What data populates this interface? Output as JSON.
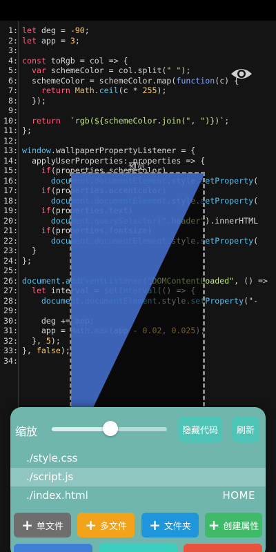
{
  "code_lines": [
    {
      "n": "1:",
      "tokens": [
        [
          "k",
          "let"
        ],
        [
          "o",
          " deg = "
        ],
        [
          "p",
          "-90"
        ],
        [
          "o",
          ";"
        ]
      ]
    },
    {
      "n": "2:",
      "tokens": [
        [
          "k",
          "let"
        ],
        [
          "o",
          " app = "
        ],
        [
          "p",
          "3"
        ],
        [
          "o",
          ";"
        ]
      ]
    },
    {
      "n": "3:",
      "tokens": []
    },
    {
      "n": "4:",
      "tokens": [
        [
          "k",
          "const"
        ],
        [
          "o",
          " toRgb = col => {"
        ]
      ]
    },
    {
      "n": "5:",
      "tokens": [
        [
          "k",
          "  var"
        ],
        [
          "o",
          " schemeColor = col.split("
        ],
        [
          "s",
          "\" \""
        ],
        [
          "o",
          ");"
        ]
      ]
    },
    {
      "n": "6:",
      "tokens": [
        [
          "o",
          "  schemeColor = schemeColor.map("
        ],
        [
          "f",
          "function"
        ],
        [
          "o",
          "(c) {"
        ]
      ]
    },
    {
      "n": "7:",
      "tokens": [
        [
          "k",
          "    return"
        ],
        [
          "o",
          " "
        ],
        [
          "y",
          "Math"
        ],
        [
          "o",
          "."
        ],
        [
          "c",
          "ceil"
        ],
        [
          "o",
          "(c * "
        ],
        [
          "p",
          "255"
        ],
        [
          "o",
          ");"
        ]
      ]
    },
    {
      "n": "8:",
      "tokens": [
        [
          "o",
          "  });"
        ]
      ]
    },
    {
      "n": "9:",
      "tokens": []
    },
    {
      "n": "10:",
      "tokens": [
        [
          "k",
          "  return"
        ],
        [
          "o",
          "  "
        ],
        [
          "s",
          "`rgb(${schemeColor.join(\", \")})`"
        ],
        [
          "o",
          ";"
        ]
      ]
    },
    {
      "n": "11:",
      "tokens": [
        [
          "o",
          "};"
        ]
      ]
    },
    {
      "n": "12:",
      "tokens": []
    },
    {
      "n": "13:",
      "tokens": [
        [
          "c",
          "window"
        ],
        [
          "o",
          ".wallpaperPropertyListener = {"
        ]
      ]
    },
    {
      "n": "14:",
      "tokens": [
        [
          "o",
          "  applyUserProperties: properties => {"
        ]
      ]
    },
    {
      "n": "15:",
      "tokens": [
        [
          "k",
          "    if"
        ],
        [
          "o",
          "(properties.schemecolor)"
        ]
      ]
    },
    {
      "n": "16:",
      "tokens": [
        [
          "o",
          "      "
        ],
        [
          "c",
          "document"
        ],
        [
          "o",
          "."
        ],
        [
          "c",
          "documentElement"
        ],
        [
          "o",
          ".style."
        ],
        [
          "c",
          "setProperty"
        ],
        [
          "o",
          "("
        ]
      ]
    },
    {
      "n": "17:",
      "tokens": [
        [
          "k",
          "    if"
        ],
        [
          "o",
          "(properties.accentcolor)"
        ]
      ]
    },
    {
      "n": "18:",
      "tokens": [
        [
          "o",
          "      "
        ],
        [
          "c",
          "document"
        ],
        [
          "o",
          "."
        ],
        [
          "c",
          "documentElement"
        ],
        [
          "o",
          ".style."
        ],
        [
          "c",
          "setProperty"
        ],
        [
          "o",
          "("
        ]
      ]
    },
    {
      "n": "19:",
      "tokens": [
        [
          "k",
          "    if"
        ],
        [
          "o",
          "(properties.text)"
        ]
      ]
    },
    {
      "n": "20:",
      "tokens": [
        [
          "o",
          "      "
        ],
        [
          "c",
          "document"
        ],
        [
          "o",
          "."
        ],
        [
          "c",
          "querySelector"
        ],
        [
          "o",
          "("
        ],
        [
          "s",
          "\".header\""
        ],
        [
          "o",
          ").innerHTML"
        ]
      ]
    },
    {
      "n": "21:",
      "tokens": [
        [
          "k",
          "    if"
        ],
        [
          "o",
          "(properties.fontsize)"
        ]
      ]
    },
    {
      "n": "22:",
      "tokens": [
        [
          "o",
          "      "
        ],
        [
          "c",
          "document"
        ],
        [
          "o",
          "."
        ],
        [
          "c",
          "documentElement"
        ],
        [
          "o",
          ".style."
        ],
        [
          "c",
          "setProperty"
        ],
        [
          "o",
          "("
        ]
      ]
    },
    {
      "n": "23:",
      "tokens": [
        [
          "o",
          "  }"
        ]
      ]
    },
    {
      "n": "24:",
      "tokens": [
        [
          "o",
          "};"
        ]
      ]
    },
    {
      "n": "25:",
      "tokens": []
    },
    {
      "n": "26:",
      "tokens": [
        [
          "c",
          "document"
        ],
        [
          "o",
          "."
        ],
        [
          "c",
          "addEventListener"
        ],
        [
          "o",
          "("
        ],
        [
          "s",
          "\"DOMContentLoaded\""
        ],
        [
          "o",
          ", () =>"
        ]
      ]
    },
    {
      "n": "27:",
      "tokens": [
        [
          "k",
          "  let"
        ],
        [
          "o",
          " interval = "
        ],
        [
          "c",
          "setInterval"
        ],
        [
          "o",
          "(() => {"
        ]
      ]
    },
    {
      "n": "28:",
      "tokens": [
        [
          "o",
          "    "
        ],
        [
          "c",
          "document"
        ],
        [
          "o",
          "."
        ],
        [
          "c",
          "documentElement"
        ],
        [
          "o",
          ".style."
        ],
        [
          "c",
          "setProperty"
        ],
        [
          "o",
          "(\"-"
        ]
      ]
    },
    {
      "n": "29:",
      "tokens": []
    },
    {
      "n": "30:",
      "tokens": [
        [
          "o",
          "    deg += app;"
        ]
      ]
    },
    {
      "n": "31:",
      "tokens": [
        [
          "o",
          "    app = "
        ],
        [
          "y",
          "Math"
        ],
        [
          "o",
          "."
        ],
        [
          "c",
          "max"
        ],
        [
          "o",
          "(app - "
        ],
        [
          "p",
          "0.02"
        ],
        [
          "o",
          ", "
        ],
        [
          "p",
          "0.025"
        ],
        [
          "o",
          ");"
        ]
      ]
    },
    {
      "n": "32:",
      "tokens": [
        [
          "o",
          "  }, "
        ],
        [
          "p",
          "5"
        ],
        [
          "o",
          ");"
        ]
      ]
    },
    {
      "n": "33:",
      "tokens": [
        [
          "o",
          "}, "
        ],
        [
          "p",
          "false"
        ],
        [
          "o",
          ");"
        ]
      ]
    },
    {
      "n": "34:",
      "tokens": []
    }
  ],
  "preview": {
    "label": "预览"
  },
  "panel": {
    "zoom_label": "缩放",
    "zoom_level": 0.51,
    "hide_code_label": "隐藏代码",
    "refresh_label": "刷新",
    "files": [
      "./style.css",
      "./script.js",
      "./index.html"
    ],
    "active_file": "./script.js",
    "home_label": "HOME"
  },
  "actions": [
    {
      "label": "单文件",
      "color": "#6e6e6e"
    },
    {
      "label": "多文件",
      "color": "#f2a31b"
    },
    {
      "label": "文件夹",
      "color": "#1f96db"
    },
    {
      "label": "创建属性",
      "color": "#3fba68"
    }
  ],
  "icons": {
    "visibility": "eye-icon",
    "add": "plus-icon"
  }
}
